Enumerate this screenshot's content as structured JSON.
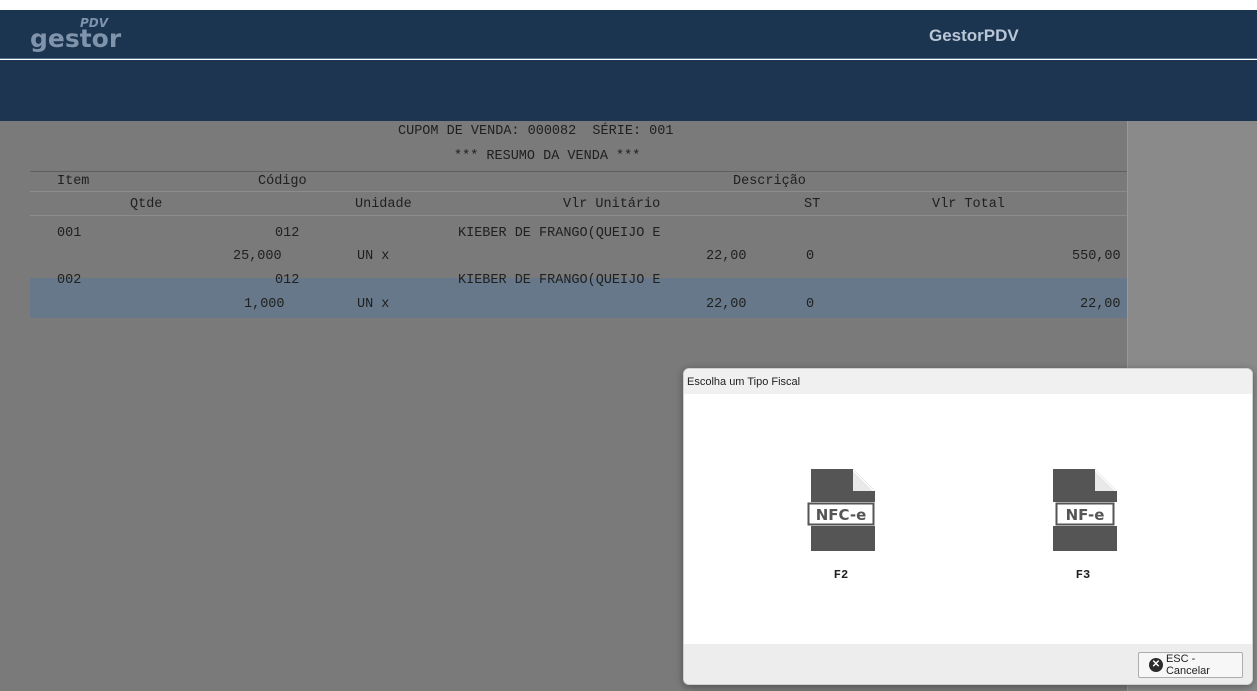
{
  "app": {
    "logo_main": "gestor",
    "logo_sup": "PDV",
    "title": "GestorPDV"
  },
  "receipt": {
    "header_line": "CUPOM DE VENDA: 000082  SÉRIE: 001",
    "summary_line": "*** RESUMO DA VENDA ***",
    "columns1": {
      "item": "Item",
      "codigo": "Código",
      "descricao": "Descrição"
    },
    "columns2": {
      "qtde": "Qtde",
      "unidade": "Unidade",
      "vlr_unitario": "Vlr Unitário",
      "st": "ST",
      "vlr_total": "Vlr Total"
    },
    "items": [
      {
        "item": "001",
        "codigo": "012",
        "descricao": "KIEBER DE FRANGO(QUEIJO E",
        "qtde": "25,000",
        "unidade": "UN x",
        "vlr_unitario": "22,00",
        "st": "0",
        "vlr_total": "550,00"
      },
      {
        "item": "002",
        "codigo": "012",
        "descricao": "KIEBER DE FRANGO(QUEIJO E",
        "qtde": "1,000",
        "unidade": "UN x",
        "vlr_unitario": "22,00",
        "st": "0",
        "vlr_total": "22,00"
      }
    ]
  },
  "dialog": {
    "title": "Escolha um Tipo Fiscal",
    "options": [
      {
        "icon": "nfce-document-icon",
        "doc_label": "NFC-e",
        "key": "F2"
      },
      {
        "icon": "nfe-document-icon",
        "doc_label": "NF-e",
        "key": "F3"
      }
    ],
    "cancel_label": "ESC - Cancelar"
  },
  "colors": {
    "header_bg": "#1b3450",
    "content_bg": "#7a7a7a",
    "selected_row": "#66788a",
    "icon_gray": "#555555"
  }
}
